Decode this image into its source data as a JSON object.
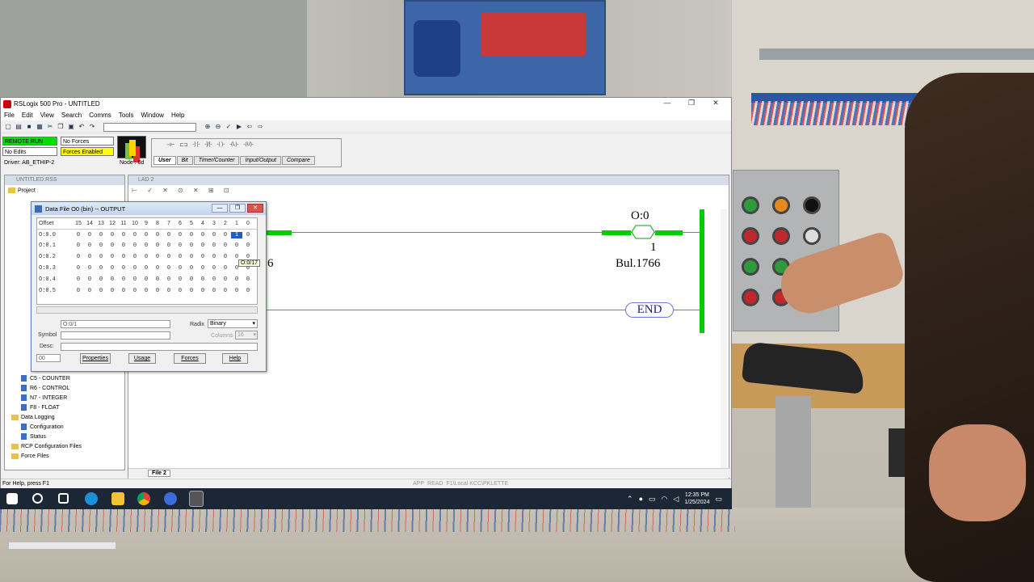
{
  "window": {
    "title": "RSLogix 500 Pro - UNTITLED",
    "controls": [
      "—",
      "❐",
      "✕"
    ]
  },
  "menu": [
    "File",
    "Edit",
    "View",
    "Search",
    "Comms",
    "Tools",
    "Window",
    "Help"
  ],
  "status_panel": {
    "mode": "REMOTE RUN",
    "edits": "No Edits",
    "forces": "No Forces",
    "forces_enabled": "Forces Enabled",
    "driver": "Driver: AB_ETHIP-2",
    "node": "Node : 0d"
  },
  "instruction_tabs": [
    "User",
    "Bit",
    "Timer/Counter",
    "Input/Output",
    "Compare"
  ],
  "project_panel": {
    "header": "UNTITLED.RSS",
    "root": "Project",
    "items": [
      {
        "type": "file",
        "label": "C5 - COUNTER"
      },
      {
        "type": "file",
        "label": "R6 - CONTROL"
      },
      {
        "type": "file",
        "label": "N7 - INTEGER"
      },
      {
        "type": "file",
        "label": "F8 - FLOAT"
      },
      {
        "type": "folder",
        "label": "Data Logging"
      },
      {
        "type": "file",
        "label": "Configuration"
      },
      {
        "type": "file",
        "label": "Status"
      },
      {
        "type": "folder",
        "label": "RCP Configuration Files"
      },
      {
        "type": "folder",
        "label": "Force Files"
      }
    ]
  },
  "ladder_panel": {
    "header": "LAD 2",
    "output_address": "O:0",
    "output_bit": "1",
    "output_label": "Bul.1766",
    "left_fragment": "6",
    "end_label": "END",
    "file_tab": "File 2"
  },
  "data_file": {
    "title": "Data File O0 (bin) -- OUTPUT",
    "columns": [
      "Offset",
      "15",
      "14",
      "13",
      "12",
      "11",
      "10",
      "9",
      "8",
      "7",
      "6",
      "5",
      "4",
      "3",
      "2",
      "1",
      "0"
    ],
    "rows": [
      {
        "offset": "O:0.0",
        "bits": [
          "0",
          "0",
          "0",
          "0",
          "0",
          "0",
          "0",
          "0",
          "0",
          "0",
          "0",
          "0",
          "0",
          "0",
          "1",
          "0"
        ]
      },
      {
        "offset": "O:0.1",
        "bits": [
          "0",
          "0",
          "0",
          "0",
          "0",
          "0",
          "0",
          "0",
          "0",
          "0",
          "0",
          "0",
          "0",
          "0",
          "0",
          "0"
        ]
      },
      {
        "offset": "O:0.2",
        "bits": [
          "0",
          "0",
          "0",
          "0",
          "0",
          "0",
          "0",
          "0",
          "0",
          "0",
          "0",
          "0",
          "0",
          "0",
          "0",
          "0"
        ]
      },
      {
        "offset": "O:0.3",
        "bits": [
          "0",
          "0",
          "0",
          "0",
          "0",
          "0",
          "0",
          "0",
          "0",
          "0",
          "0",
          "0",
          "0",
          "0",
          "0",
          "0"
        ]
      },
      {
        "offset": "O:0.4",
        "bits": [
          "0",
          "0",
          "0",
          "0",
          "0",
          "0",
          "0",
          "0",
          "0",
          "0",
          "0",
          "0",
          "0",
          "0",
          "0",
          "0"
        ]
      },
      {
        "offset": "O:0.5",
        "bits": [
          "0",
          "0",
          "0",
          "0",
          "0",
          "0",
          "0",
          "0",
          "0",
          "0",
          "0",
          "0",
          "0",
          "0",
          "0",
          "0"
        ]
      }
    ],
    "selected_row": 0,
    "selected_bit_index": 14,
    "tooltip": "O:0/17",
    "address_value": "O:0/1",
    "radix_label": "Radix",
    "radix_value": "Binary",
    "symbol_label": "Symbol",
    "columns_label": "Columns",
    "columns_value": "16",
    "desc_label": "Desc:",
    "spin_value": "00",
    "buttons": [
      "Properties",
      "Usage",
      "Forces",
      "Help"
    ]
  },
  "statusbar": {
    "help": "For Help, press F1",
    "cells": [
      "APP",
      "READ",
      "F1\\Local KCC\\PKLETTE"
    ]
  },
  "taskbar": {
    "time": "12:35 PM",
    "date": "1/25/2024"
  }
}
